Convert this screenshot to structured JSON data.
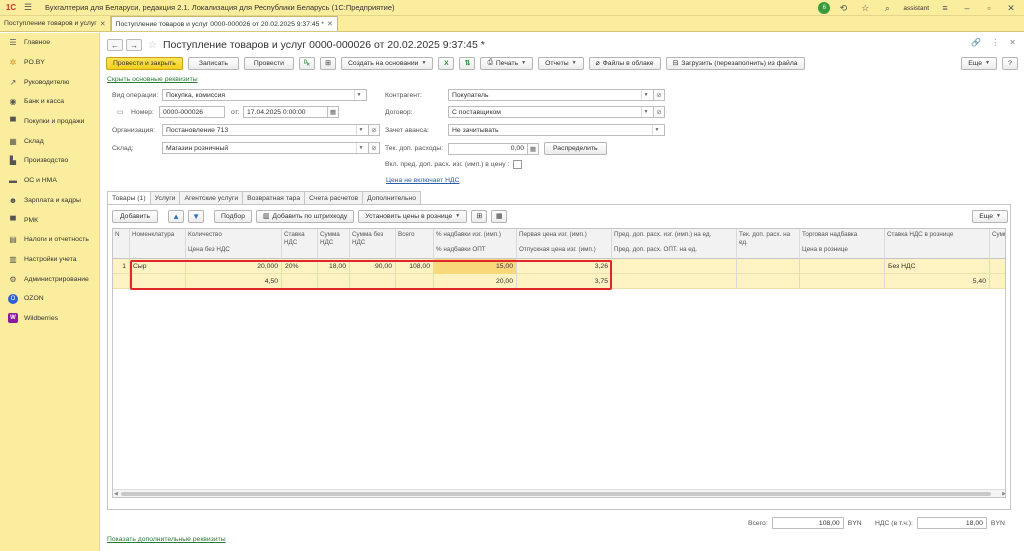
{
  "app": {
    "logo": "1С",
    "title": "Бухгалтерия для Беларуси, редакция 2.1. Локализация для Республики Беларусь   (1С:Предприятие)",
    "badge_count": "6",
    "user": "assistant"
  },
  "window_tabs": [
    {
      "label": "Поступление товаров и услуг",
      "active": false
    },
    {
      "label": "Поступление товаров и услуг 0000-000026 от 20.02.2025 9:37:45 *",
      "active": true
    }
  ],
  "sidebar": {
    "items": [
      {
        "label": "Главное",
        "icon": "menu-icon"
      },
      {
        "label": "PO.BY",
        "icon": "po-icon"
      },
      {
        "label": "Руководителю",
        "icon": "chart-icon"
      },
      {
        "label": "Банк и касса",
        "icon": "bank-icon"
      },
      {
        "label": "Покупки и продажи",
        "icon": "cart-icon"
      },
      {
        "label": "Склад",
        "icon": "warehouse-icon"
      },
      {
        "label": "Производство",
        "icon": "factory-icon"
      },
      {
        "label": "ОС и НМА",
        "icon": "truck-icon"
      },
      {
        "label": "Зарплата и кадры",
        "icon": "people-icon"
      },
      {
        "label": "РМК",
        "icon": "cart2-icon"
      },
      {
        "label": "Налоги и отчетность",
        "icon": "tax-icon"
      },
      {
        "label": "Настройки учета",
        "icon": "settings-icon"
      },
      {
        "label": "Администрирование",
        "icon": "gear-icon"
      },
      {
        "label": "OZON",
        "icon": "ozon-icon"
      },
      {
        "label": "Wildberries",
        "icon": "wb-icon"
      }
    ]
  },
  "document": {
    "title": "Поступление товаров и услуг 0000-000026 от 20.02.2025 9:37:45 *"
  },
  "toolbar": {
    "post_close": "Провести и закрыть",
    "save": "Записать",
    "post": "Провести",
    "create_based": "Создать на основании",
    "print": "Печать",
    "reports": "Отчеты",
    "cloud_files": "Файлы в облаке",
    "upload": "Загрузить (перезаполнить) из файла",
    "more": "Еще"
  },
  "links": {
    "hide_main": "Скрыть основные реквизиты",
    "price_no_vat": "Цена не включает НДС",
    "show_additional": "Показать дополнительные реквизиты"
  },
  "form": {
    "operation_label": "Вид операции:",
    "operation_value": "Покупка, комиссия",
    "number_label": "Номер:",
    "number_value": "0000-000026",
    "date_label": "от:",
    "date_value": "17.04.2025  0:00:00",
    "org_label": "Организация:",
    "org_value": "Постановление 713",
    "warehouse_label": "Склад:",
    "warehouse_value": "Магазин розничный",
    "counterparty_label": "Контрагент:",
    "counterparty_value": "Покупатель",
    "contract_label": "Договор:",
    "contract_value": "С поставщиком",
    "advance_label": "Зачет аванса:",
    "advance_value": "Не зачитывать",
    "extra_cost_label": "Тек. доп. расходы:",
    "extra_cost_value": "0,00",
    "distribute": "Распределить",
    "include_label": "Вкл. пред. доп. расх. изг. (имп.) в цену :"
  },
  "subtabs": [
    {
      "label": "Товары (1)",
      "active": true
    },
    {
      "label": "Услуги",
      "active": false
    },
    {
      "label": "Агентские услуги",
      "active": false
    },
    {
      "label": "Возвратная тара",
      "active": false
    },
    {
      "label": "Счета расчетов",
      "active": false
    },
    {
      "label": "Дополнительно",
      "active": false
    }
  ],
  "table_toolbar": {
    "add": "Добавить",
    "pick": "Подбор",
    "barcode": "Добавить по штрихкоду",
    "set_prices": "Установить цены в рознице",
    "more": "Еще"
  },
  "table": {
    "headers": {
      "n": "N",
      "nomenclature": "Номенклатура",
      "qty": "Количество",
      "price_no_vat": "Цена без НДС",
      "vat_rate": "Ставка НДС",
      "vat_sum": "Сумма НДС",
      "sum_no_vat": "Сумма без НДС",
      "total": "Всего",
      "markup_imp": "% надбавки изг. (имп.)",
      "markup_opt": "% надбавки ОПТ",
      "first_price": "Первая цена изг. (имп.)",
      "release_price": "Отпускная цена изг. (имп.)",
      "prev_cost": "Пред. доп. расх. изг. (имп.) на ед.",
      "prev_cost_opt": "Пред. доп. расх. ОПТ. на ед.",
      "cur_cost": "Тек. доп. расх. на ед.",
      "trade_markup": "Торговая надбавка",
      "retail_price": "Цена в рознице",
      "retail_vat": "Ставка НДС в рознице",
      "sum_col": "Сумма"
    },
    "row": {
      "n": "1",
      "nomenclature": "Сыр",
      "qty": "20,000",
      "price_no_vat": "4,50",
      "vat_rate": "20%",
      "vat_sum": "18,00",
      "sum_no_vat": "90,00",
      "total": "108,00",
      "markup_imp": "15,00",
      "markup_opt": "20,00",
      "first_price": "3,26",
      "release_price": "3,75",
      "retail_vat": "Без НДС",
      "retail_extra": "5,40"
    }
  },
  "totals": {
    "total_label": "Всего:",
    "total_value": "108,00",
    "currency": "BYN",
    "vat_label": "НДС (в т.ч.):",
    "vat_value": "18,00",
    "currency2": "BYN"
  }
}
